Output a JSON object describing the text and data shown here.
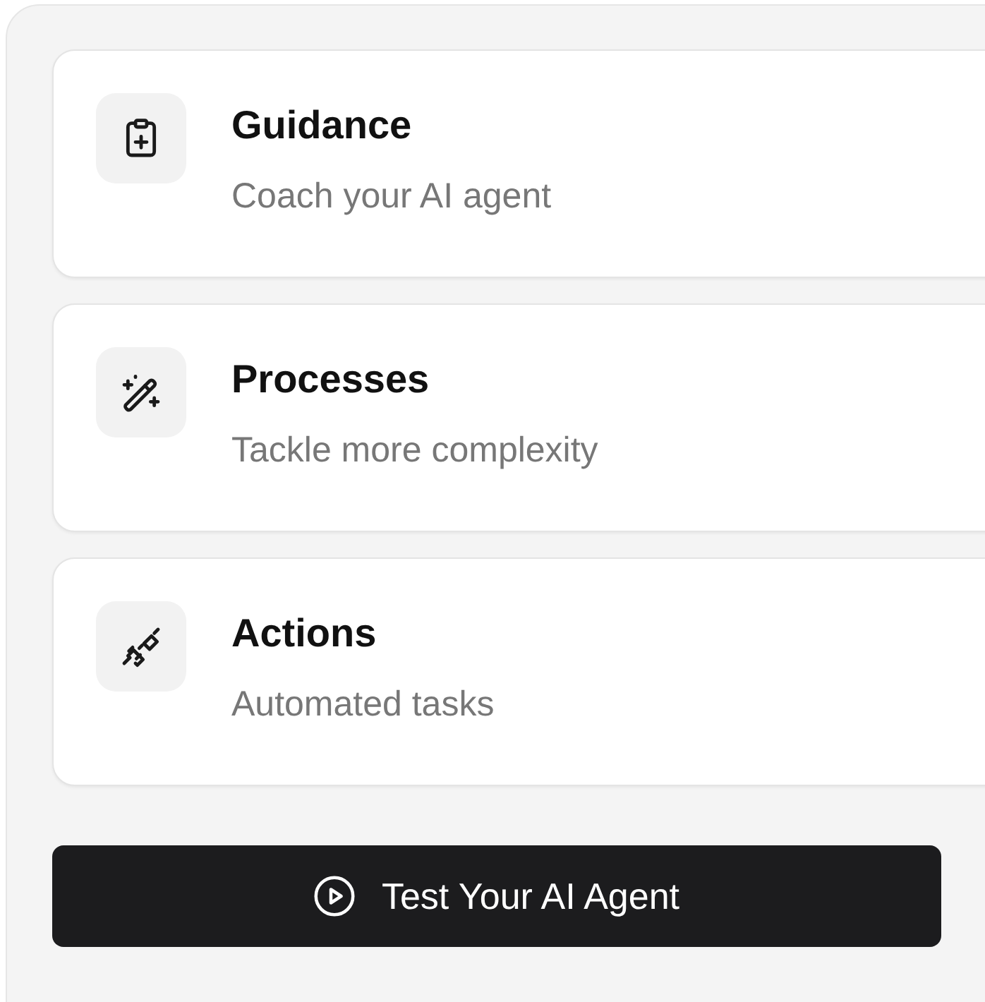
{
  "items": [
    {
      "title": "Guidance",
      "subtitle": "Coach your AI agent"
    },
    {
      "title": "Processes",
      "subtitle": "Tackle more complexity"
    },
    {
      "title": "Actions",
      "subtitle": "Automated tasks"
    }
  ],
  "button": {
    "label": "Test Your AI Agent"
  }
}
